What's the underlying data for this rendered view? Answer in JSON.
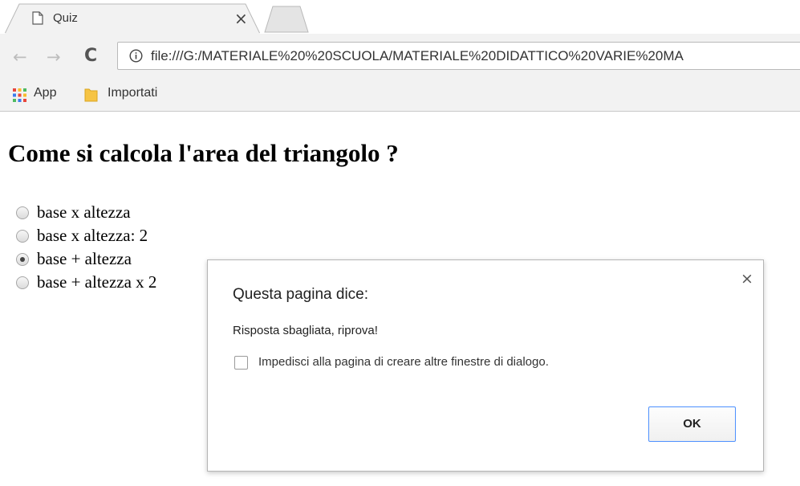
{
  "browser": {
    "tab": {
      "title": "Quiz",
      "close_symbol": "×",
      "icon": "page-icon"
    },
    "toolbar": {
      "back_symbol": "←",
      "forward_symbol": "→",
      "reload_symbol": "C",
      "url": "file:///G:/MATERIALE%20%20SCUOLA/MATERIALE%20DIDATTICO%20VARIE%20MA"
    },
    "bookmarks": [
      {
        "label": "App",
        "icon": "apps-grid-icon"
      },
      {
        "label": "Importati",
        "icon": "folder-icon"
      }
    ]
  },
  "page": {
    "question": "Come si calcola l'area del triangolo ?",
    "options": [
      {
        "label": "base x altezza",
        "checked": false
      },
      {
        "label": "base x altezza: 2",
        "checked": false
      },
      {
        "label": "base + altezza",
        "checked": true
      },
      {
        "label": "base + altezza x 2",
        "checked": false
      }
    ]
  },
  "dialog": {
    "title": "Questa pagina dice:",
    "message": "Risposta sbagliata, riprova!",
    "checkbox_label": "Impedisci alla pagina di creare altre finestre di dialogo.",
    "checkbox_checked": false,
    "ok_label": "OK",
    "close_symbol": "×"
  },
  "colors": {
    "chrome_bg": "#f2f2f2",
    "ok_border": "#4d90fe",
    "apps_grid": [
      "#e8453c",
      "#f9bb2d",
      "#4ebb61",
      "#3b7ded"
    ],
    "folder": "#f6c444"
  }
}
